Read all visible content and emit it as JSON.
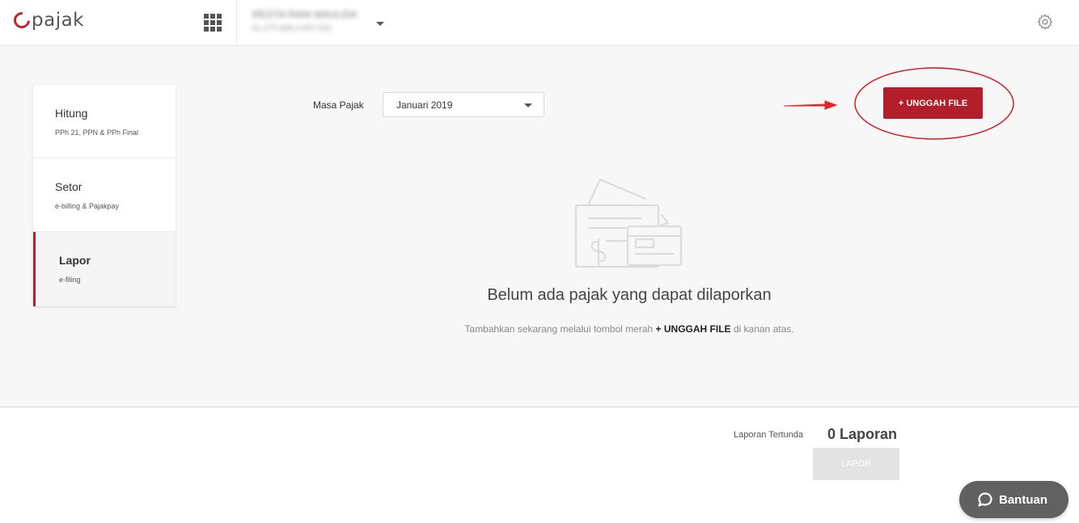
{
  "header": {
    "logo_text": "pajak",
    "account_name": "REZITA RANI MAULIDA",
    "account_id": "81.979.908.4-807.000"
  },
  "sidebar": {
    "items": [
      {
        "title": "Hitung",
        "subtitle": "PPh 21, PPN & PPh Final"
      },
      {
        "title": "Setor",
        "subtitle": "e-billing & Pajakpay"
      },
      {
        "title": "Lapor",
        "subtitle": "e-filing"
      }
    ]
  },
  "filter": {
    "label": "Masa Pajak",
    "selected": "Januari 2019"
  },
  "upload_button": "+ UNGGAH FILE",
  "empty_state": {
    "title": "Belum ada pajak yang dapat dilaporkan",
    "subtitle_prefix": "Tambahkan sekarang melalui tombol merah ",
    "subtitle_strong": "+ UNGGAH FILE",
    "subtitle_suffix": " di kanan atas."
  },
  "footer": {
    "pending_label": "Laporan Tertunda",
    "pending_count": "0 Laporan",
    "lapor_button": "LAPOR"
  },
  "help_button": "Bantuan",
  "colors": {
    "brand_red": "#b21f2a",
    "annotation_red": "#e32222"
  }
}
